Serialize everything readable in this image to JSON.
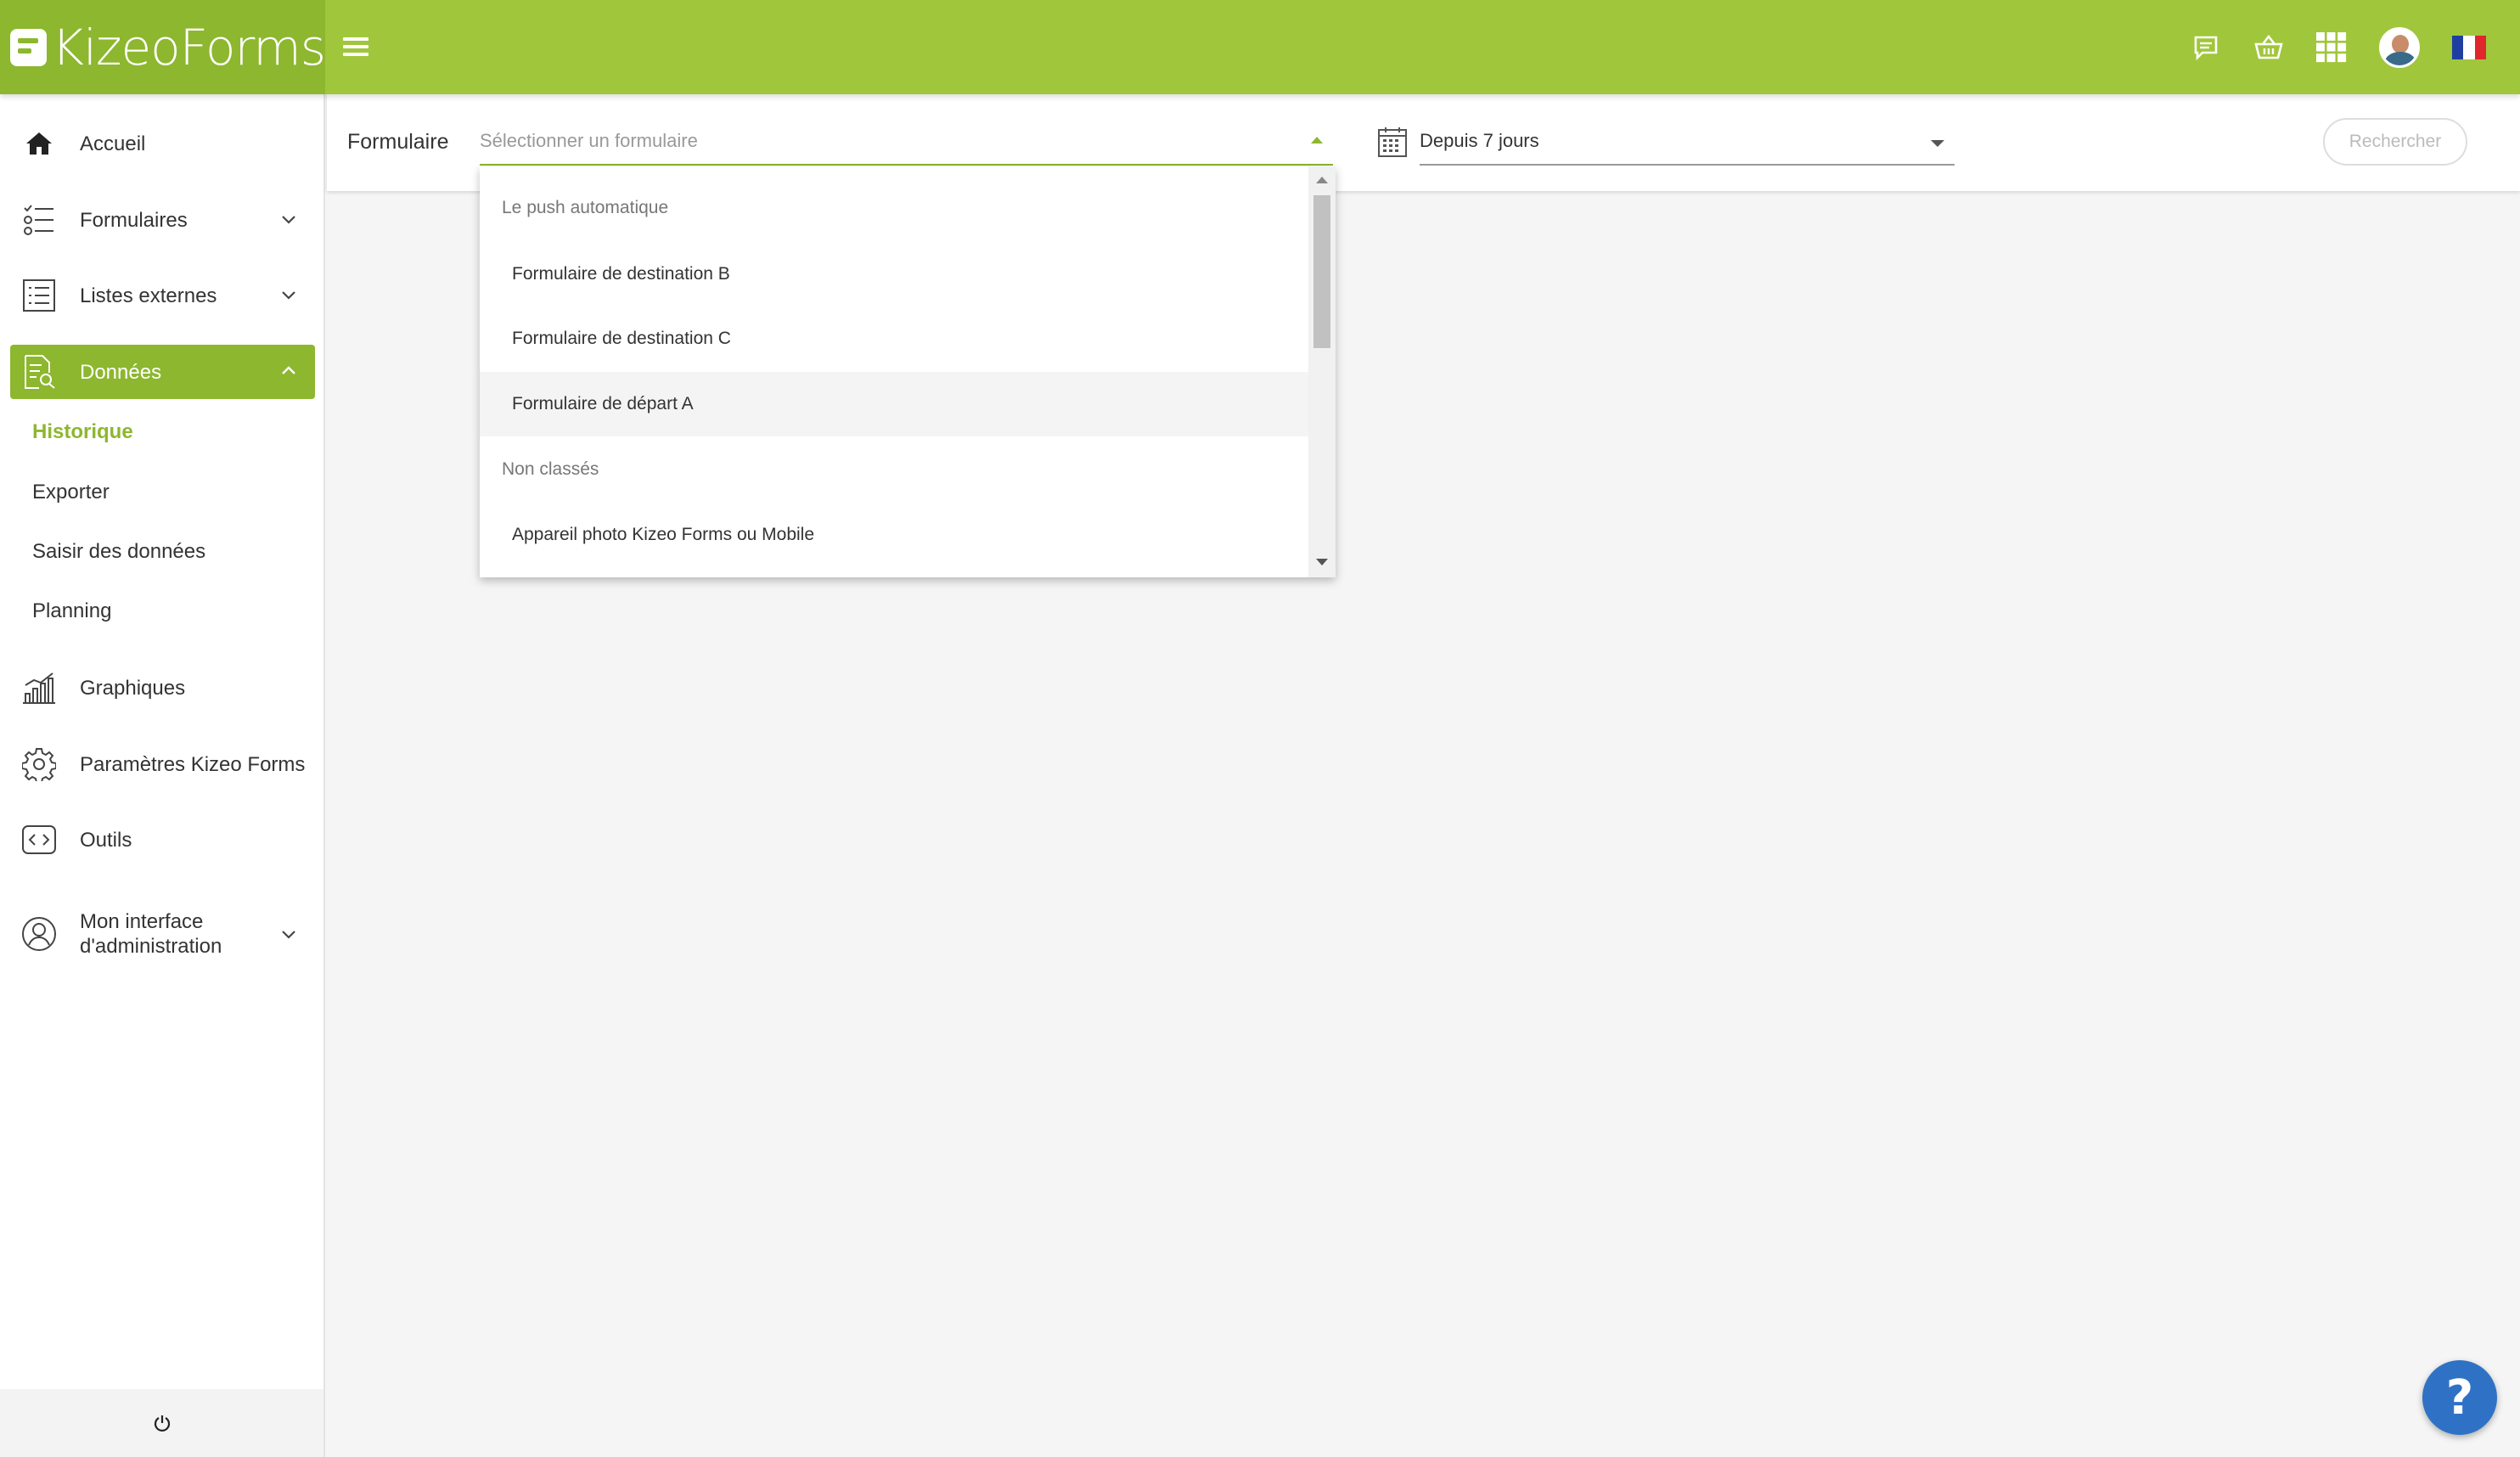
{
  "app": {
    "logo_text": "KizeoForms",
    "brand_color": "#a0c63b",
    "brand_dark": "#8db72e"
  },
  "topbar": {
    "icons": [
      "message-icon",
      "basket-icon",
      "apps-grid-icon",
      "avatar",
      "flag-fr-icon"
    ]
  },
  "sidebar": {
    "items": [
      {
        "label": "Accueil",
        "icon": "home-icon"
      },
      {
        "label": "Formulaires",
        "icon": "forms-list-icon"
      },
      {
        "label": "Listes externes",
        "icon": "external-list-icon"
      },
      {
        "label": "Données",
        "icon": "data-search-icon"
      },
      {
        "label": "Graphiques",
        "icon": "bar-chart-icon"
      },
      {
        "label": "Paramètres Kizeo Forms",
        "icon": "gear-icon"
      },
      {
        "label": "Outils",
        "icon": "code-icon"
      },
      {
        "label": "Mon interface d'administration",
        "icon": "user-circle-icon"
      }
    ],
    "sub_items": [
      "Historique",
      "Exporter",
      "Saisir des données",
      "Planning"
    ],
    "current_sub": "Historique"
  },
  "filters": {
    "form_label": "Formulaire",
    "form_placeholder": "Sélectionner un formulaire",
    "period_value": "Depuis 7 jours",
    "search_label": "Rechercher"
  },
  "dropdown": {
    "groups": [
      {
        "label": "Le push automatique",
        "options": [
          "Formulaire de destination B",
          "Formulaire de destination C",
          "Formulaire de départ A"
        ]
      },
      {
        "label": "Non classés",
        "options": [
          "Appareil photo Kizeo Forms ou Mobile"
        ]
      }
    ],
    "hovered_option": "Formulaire de départ A"
  },
  "help": {
    "label": "?"
  }
}
